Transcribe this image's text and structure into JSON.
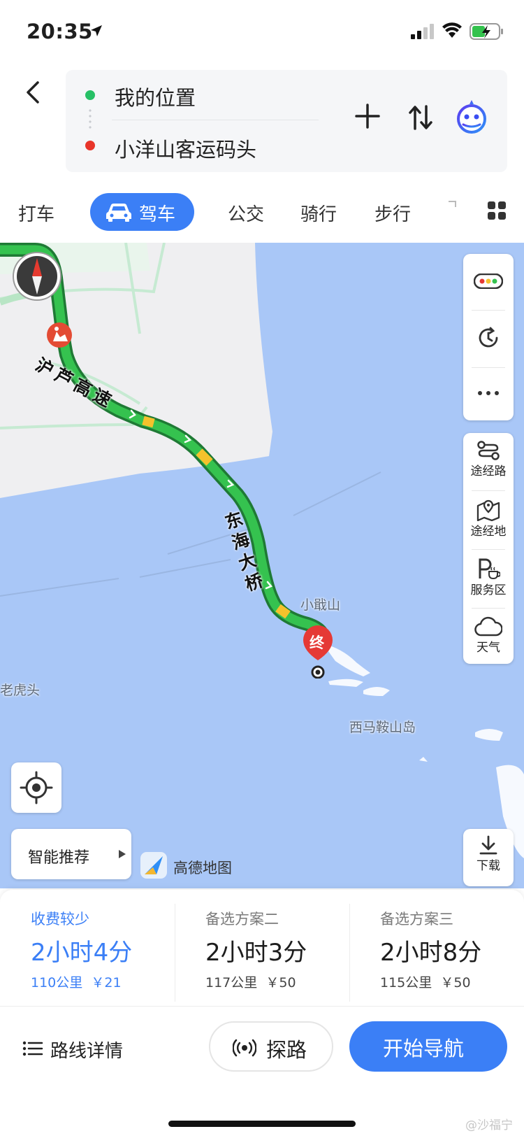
{
  "status_bar": {
    "time": "20:35",
    "icons": [
      "location-arrow-icon",
      "cellular-signal-icon",
      "wifi-icon",
      "battery-charging-icon"
    ]
  },
  "route": {
    "origin": "我的位置",
    "destination": "小洋山客运码头",
    "actions": [
      "back-icon",
      "add-waypoint-icon",
      "swap-icon",
      "voice-assistant-icon"
    ]
  },
  "modes": {
    "tabs": [
      "打车",
      "驾车",
      "公交",
      "骑行",
      "步行"
    ],
    "active": "驾车"
  },
  "map": {
    "labels": {
      "road_1": "沪芦高速",
      "road_2": "东海大桥",
      "island_1": "小戢山",
      "island_2": "西马鞍山岛",
      "place_1": "老虎头"
    },
    "end_marker": "终",
    "route_color": "#2fb24a",
    "water_color": "#a9c7f7",
    "land_color": "#efeff1"
  },
  "side_panel": {
    "items": [
      {
        "icon": "traffic-light-icon",
        "label": ""
      },
      {
        "icon": "clock-refresh-icon",
        "label": ""
      },
      {
        "icon": "more-icon",
        "label": ""
      }
    ],
    "tools": [
      {
        "icon": "waypoint-route-icon",
        "label": "途经路"
      },
      {
        "icon": "waypoint-place-icon",
        "label": "途经地"
      },
      {
        "icon": "service-area-icon",
        "label": "服务区"
      },
      {
        "icon": "weather-icon",
        "label": "天气"
      }
    ],
    "download": "下载"
  },
  "map_controls": {
    "smart_recommend": "智能推荐",
    "brand": "高德地图"
  },
  "options": [
    {
      "title": "收费较少",
      "duration": "2小时4分",
      "distance": "110公里",
      "price": "￥21"
    },
    {
      "title": "备选方案二",
      "duration": "2小时3分",
      "distance": "117公里",
      "price": "￥50"
    },
    {
      "title": "备选方案三",
      "duration": "2小时8分",
      "distance": "115公里",
      "price": "￥50"
    }
  ],
  "actions": {
    "details": "路线详情",
    "explore": "探路",
    "navigate": "开始导航"
  },
  "watermark": "@沙福宁",
  "colors": {
    "accent": "#3b7ff6",
    "start_dot": "#27c066",
    "end_dot": "#e8352a"
  }
}
